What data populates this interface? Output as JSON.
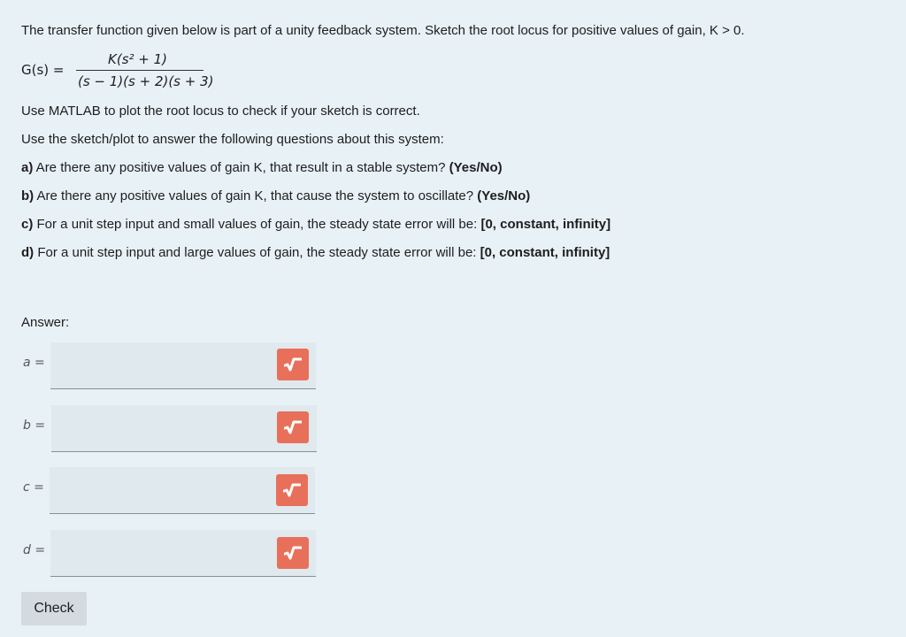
{
  "question": {
    "intro": "The transfer function given below is part of a unity feedback system.  Sketch the root locus for positive values of gain, K > 0.",
    "formula": {
      "lhs": "G(s) =",
      "numerator": "K(s² + 1)",
      "denominator": "(s − 1)(s + 2)(s + 3)"
    },
    "matlab_note": "Use MATLAB to plot the root locus to check if your sketch is correct.",
    "instruction": "Use the sketch/plot to answer the following questions about this system:",
    "parts": [
      {
        "label": "a)",
        "text": " Are there any positive values of gain K, that result in a stable system? ",
        "options": "(Yes/No)"
      },
      {
        "label": "b)",
        "text": " Are there any positive values of gain K, that cause the system to oscillate? ",
        "options": "(Yes/No)"
      },
      {
        "label": "c)",
        "text": "  For a unit step input and small values of gain, the steady state error will be: ",
        "options": "[0, constant, infinity]"
      },
      {
        "label": "d)",
        "text": "  For a unit step input and large values of gain, the steady state error will be: ",
        "options": "[0, constant, infinity]"
      }
    ]
  },
  "answer": {
    "heading": "Answer:",
    "rows": [
      {
        "var": "a",
        "eq": "=",
        "value": ""
      },
      {
        "var": "b",
        "eq": "=",
        "value": ""
      },
      {
        "var": "c",
        "eq": "=",
        "value": ""
      },
      {
        "var": "d",
        "eq": "=",
        "value": ""
      }
    ],
    "badge_icon": "square-root-icon",
    "badge_color": "#e8705a"
  },
  "check_button": {
    "label": "Check"
  }
}
